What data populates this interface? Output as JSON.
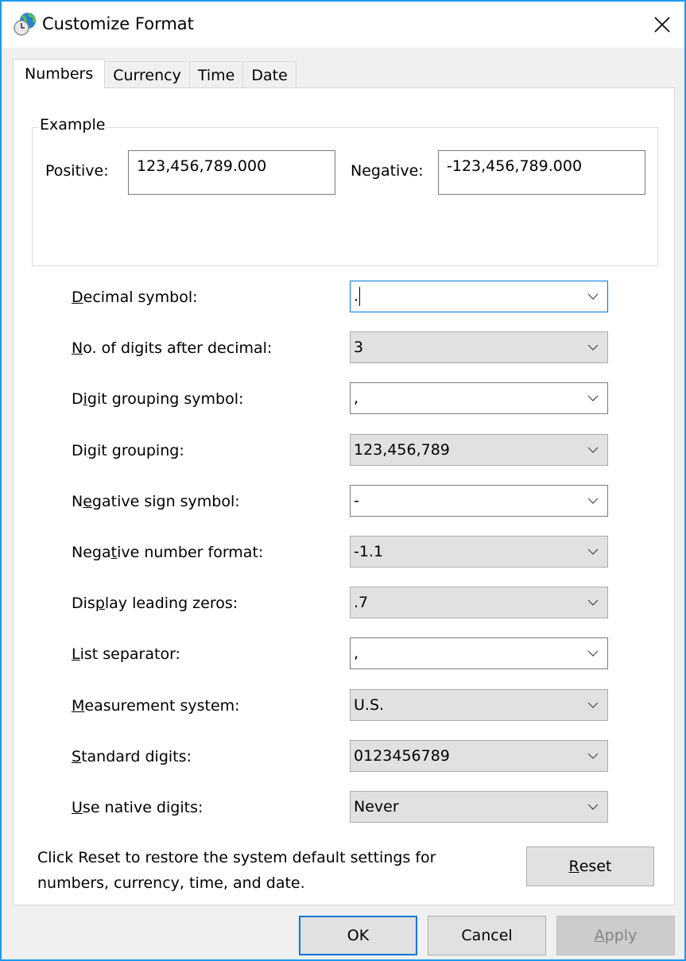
{
  "window": {
    "title": "Customize Format",
    "icon": "globe-clock-icon",
    "close_icon": "close-icon"
  },
  "tabs": [
    {
      "label": "Numbers",
      "active": true
    },
    {
      "label": "Currency",
      "active": false
    },
    {
      "label": "Time",
      "active": false
    },
    {
      "label": "Date",
      "active": false
    }
  ],
  "example": {
    "legend": "Example",
    "positive_label": "Positive:",
    "positive_value": "123,456,789.000",
    "negative_label": "Negative:",
    "negative_value": "-123,456,789.000"
  },
  "settings": [
    {
      "label_pre": "",
      "label_key": "D",
      "label_post": "ecimal symbol:",
      "value": ".",
      "editable": true,
      "focused": true
    },
    {
      "label_pre": "",
      "label_key": "N",
      "label_post": "o. of digits after decimal:",
      "value": "3",
      "editable": false,
      "focused": false
    },
    {
      "label_pre": "D",
      "label_key": "i",
      "label_post": "git grouping symbol:",
      "value": ",",
      "editable": true,
      "focused": false
    },
    {
      "label_pre": "Di",
      "label_key": "g",
      "label_post": "it grouping:",
      "value": "123,456,789",
      "editable": false,
      "focused": false
    },
    {
      "label_pre": "N",
      "label_key": "e",
      "label_post": "gative sign symbol:",
      "value": "-",
      "editable": true,
      "focused": false
    },
    {
      "label_pre": "Nega",
      "label_key": "t",
      "label_post": "ive number format:",
      "value": "-1.1",
      "editable": false,
      "focused": false
    },
    {
      "label_pre": "Dis",
      "label_key": "p",
      "label_post": "lay leading zeros:",
      "value": ".7",
      "editable": false,
      "focused": false
    },
    {
      "label_pre": "",
      "label_key": "L",
      "label_post": "ist separator:",
      "value": ",",
      "editable": true,
      "focused": false
    },
    {
      "label_pre": "",
      "label_key": "M",
      "label_post": "easurement system:",
      "value": "U.S.",
      "editable": false,
      "focused": false
    },
    {
      "label_pre": "",
      "label_key": "S",
      "label_post": "tandard digits:",
      "value": "0123456789",
      "editable": false,
      "focused": false
    },
    {
      "label_pre": "",
      "label_key": "U",
      "label_post": "se native digits:",
      "value": "Never",
      "editable": false,
      "focused": false
    }
  ],
  "reset": {
    "text": "Click Reset to restore the system default settings for numbers, currency, time, and date.",
    "button_key": "R",
    "button_rest": "eset"
  },
  "footer": {
    "ok": "OK",
    "cancel": "Cancel",
    "apply_key": "A",
    "apply_rest": "pply"
  },
  "colors": {
    "window_border": "#1a9bf0",
    "focus_accent": "#0078d7"
  }
}
